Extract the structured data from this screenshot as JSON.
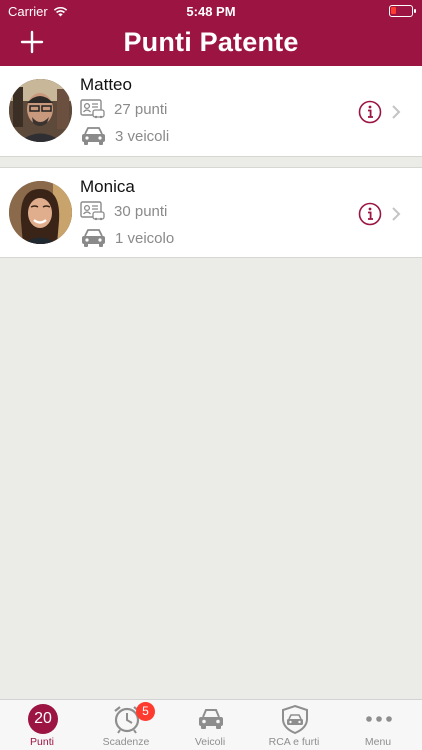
{
  "status_bar": {
    "carrier": "Carrier",
    "time": "5:48 PM"
  },
  "header": {
    "title": "Punti Patente"
  },
  "drivers": [
    {
      "name": "Matteo",
      "points": "27 punti",
      "vehicles": "3 veicoli"
    },
    {
      "name": "Monica",
      "points": "30 punti",
      "vehicles": "1 veicolo"
    }
  ],
  "tabbar": {
    "punti_value": "20",
    "scadenze_badge": "5",
    "tabs": [
      {
        "label": "Punti",
        "icon": "points-badge-icon"
      },
      {
        "label": "Scadenze",
        "icon": "alarm-clock-icon"
      },
      {
        "label": "Veicoli",
        "icon": "car-icon"
      },
      {
        "label": "RCA e furti",
        "icon": "car-shield-icon"
      },
      {
        "label": "Menu",
        "icon": "more-dots-icon"
      }
    ]
  },
  "colors": {
    "brand": "#9b1442",
    "badge": "#ff3b30",
    "background": "#ebebe7"
  }
}
